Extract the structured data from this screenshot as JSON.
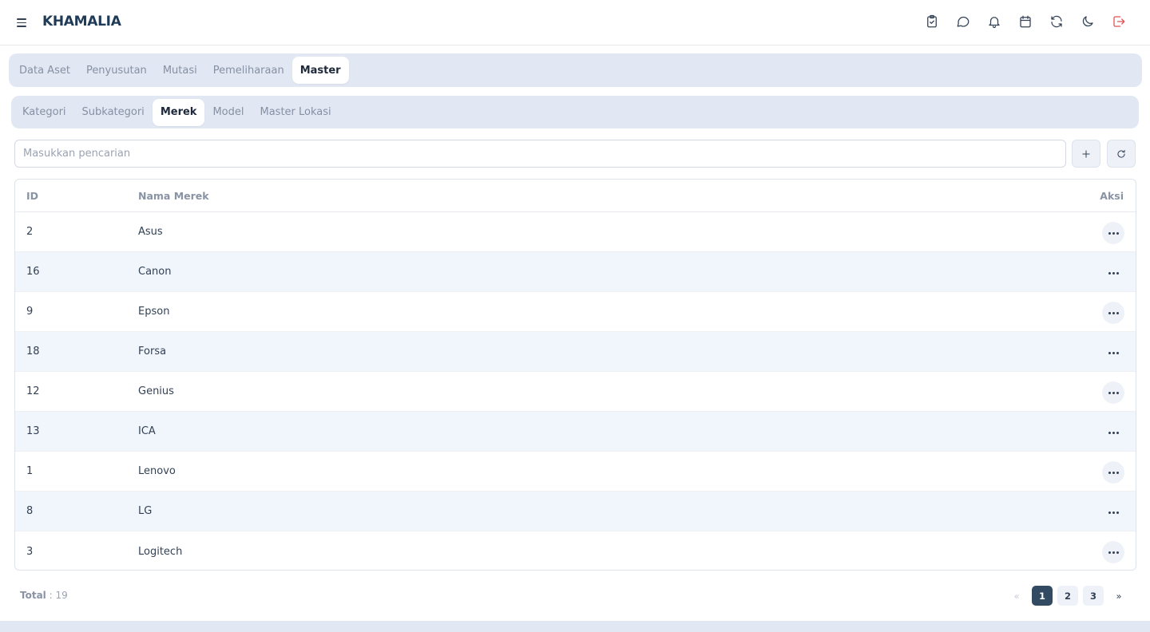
{
  "app": {
    "title": "KHAMALIA"
  },
  "header_icons": [
    {
      "name": "clipboard-check-icon"
    },
    {
      "name": "chat-bubble-icon"
    },
    {
      "name": "bell-icon"
    },
    {
      "name": "calendar-icon"
    },
    {
      "name": "refresh-cycle-icon"
    },
    {
      "name": "moon-icon"
    },
    {
      "name": "logout-icon",
      "color": "#e05252"
    }
  ],
  "main_tabs": [
    {
      "label": "Data Aset",
      "active": false
    },
    {
      "label": "Penyusutan",
      "active": false
    },
    {
      "label": "Mutasi",
      "active": false
    },
    {
      "label": "Pemeliharaan",
      "active": false
    },
    {
      "label": "Master",
      "active": true
    }
  ],
  "sub_tabs": [
    {
      "label": "Kategori",
      "active": false
    },
    {
      "label": "Subkategori",
      "active": false
    },
    {
      "label": "Merek",
      "active": true
    },
    {
      "label": "Model",
      "active": false
    },
    {
      "label": "Master Lokasi",
      "active": false
    }
  ],
  "search": {
    "placeholder": "Masukkan pencarian",
    "value": ""
  },
  "toolbar": {
    "add_icon": "plus-icon",
    "reload_icon": "reload-icon"
  },
  "table": {
    "headers": {
      "id": "ID",
      "name": "Nama Merek",
      "action": "Aksi"
    },
    "rows": [
      {
        "id": "2",
        "name": "Asus"
      },
      {
        "id": "16",
        "name": "Canon"
      },
      {
        "id": "9",
        "name": "Epson"
      },
      {
        "id": "18",
        "name": "Forsa"
      },
      {
        "id": "12",
        "name": "Genius"
      },
      {
        "id": "13",
        "name": "ICA"
      },
      {
        "id": "1",
        "name": "Lenovo"
      },
      {
        "id": "8",
        "name": "LG"
      },
      {
        "id": "3",
        "name": "Logitech"
      }
    ]
  },
  "footer": {
    "total_label": "Total",
    "total_sep": " : ",
    "total_value": "19"
  },
  "pagination": {
    "prev": "«",
    "pages": [
      "1",
      "2",
      "3"
    ],
    "current": "1",
    "next": "»"
  },
  "colors": {
    "accent": "#334a63",
    "tab_bg": "#e2e8f3",
    "row_alt": "#f1f5fc",
    "danger": "#e05252"
  }
}
